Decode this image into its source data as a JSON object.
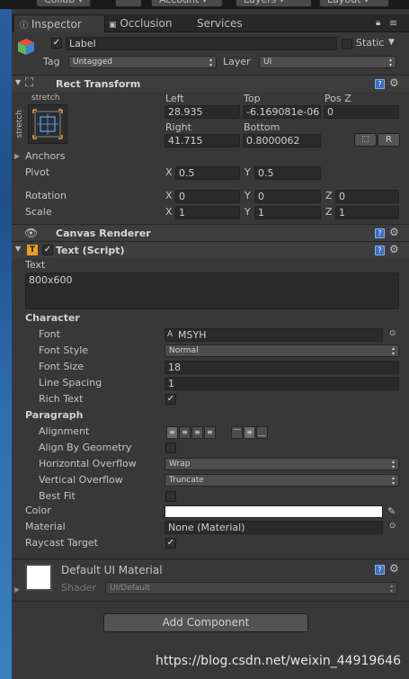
{
  "toolbar": {
    "collab": "Collab ▾",
    "account": "Account ▾",
    "layers": "Layers ▾",
    "layout": "Layout ▾"
  },
  "tabs": [
    {
      "label": "Inspector",
      "icon": "info-icon"
    },
    {
      "label": "Occlusion",
      "icon": "occlusion-icon"
    },
    {
      "label": "Services",
      "icon": ""
    }
  ],
  "object": {
    "name": "Label",
    "static_label": "Static",
    "tag_label": "Tag",
    "tag_value": "Untagged",
    "layer_label": "Layer",
    "layer_value": "UI",
    "active": true
  },
  "rect_transform": {
    "title": "Rect Transform",
    "stretch_top": "stretch",
    "stretch_side": "stretch",
    "col1_top": "Left",
    "col2_top": "Top",
    "col3_top": "Pos Z",
    "left": "28.935",
    "top": "-6.169081e-06",
    "posz": "0",
    "col1_bottom": "Right",
    "col2_bottom": "Bottom",
    "right": "41.715",
    "bottom": "0.8000062",
    "r_btn": "R",
    "anchors": "Anchors",
    "pivot": "Pivot",
    "pivot_x": "0.5",
    "pivot_y": "0.5",
    "rotation": "Rotation",
    "rot_x": "0",
    "rot_y": "0",
    "rot_z": "0",
    "scale": "Scale",
    "scale_x": "1",
    "scale_y": "1",
    "scale_z": "1",
    "x": "X",
    "y": "Y",
    "z": "Z"
  },
  "canvas_renderer": {
    "title": "Canvas Renderer"
  },
  "text_script": {
    "title": "Text (Script)",
    "text_label": "Text",
    "text_value": "800x600",
    "character": "Character",
    "font_label": "Font",
    "font_value": "MSYH",
    "font_style_label": "Font Style",
    "font_style_value": "Normal",
    "font_size_label": "Font Size",
    "font_size_value": "18",
    "line_spacing_label": "Line Spacing",
    "line_spacing_value": "1",
    "rich_text_label": "Rich Text",
    "rich_text": true,
    "paragraph": "Paragraph",
    "alignment_label": "Alignment",
    "align_by_geometry_label": "Align By Geometry",
    "align_by_geometry": false,
    "h_overflow_label": "Horizontal Overflow",
    "h_overflow_value": "Wrap",
    "v_overflow_label": "Vertical Overflow",
    "v_overflow_value": "Truncate",
    "best_fit_label": "Best Fit",
    "best_fit": false,
    "color_label": "Color",
    "color_value": "#ffffff",
    "material_label": "Material",
    "material_value": "None (Material)",
    "raycast_label": "Raycast Target",
    "raycast": true
  },
  "material": {
    "title": "Default UI Material",
    "shader_label": "Shader",
    "shader_value": "UI/Default"
  },
  "add_component": "Add Component",
  "watermark": "https://blog.csdn.net/weixin_44919646",
  "check_mark": "✓",
  "colors": {
    "panel": "#383838",
    "header": "#3d3d3d",
    "field": "#2a2a2a",
    "accent": "#3b6fc2"
  }
}
